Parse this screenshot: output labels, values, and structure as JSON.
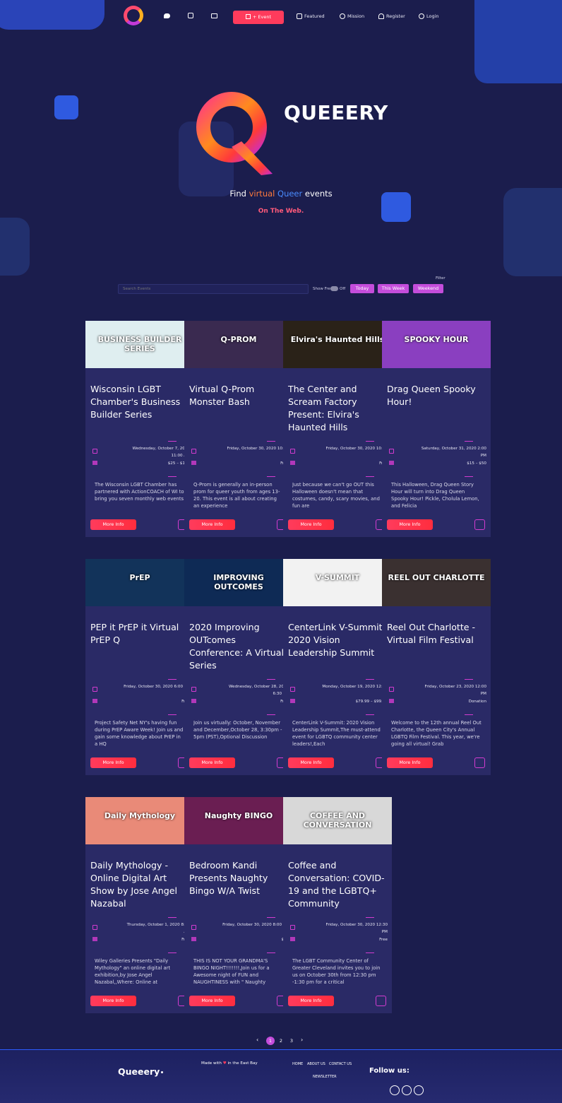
{
  "brand": {
    "name": "QUEEERY",
    "footer_name": "Queeery"
  },
  "colors": {
    "background": "#1b1d4d",
    "card": "#2a2a66",
    "accent_pink": "#ff3b5c",
    "accent_purple": "#c44ddb",
    "virtual_word": "#ff7a3d",
    "queer_word": "#4a8cff"
  },
  "header": {
    "social_icons": [
      "twitter-icon",
      "instagram-icon",
      "email-icon"
    ],
    "event_button": "+ Event",
    "nav": [
      {
        "label": "Featured",
        "icon": "featured-icon"
      },
      {
        "label": "Mission",
        "icon": "mission-icon"
      },
      {
        "label": "Register",
        "icon": "user-icon"
      },
      {
        "label": "Login",
        "icon": "power-icon"
      }
    ]
  },
  "hero": {
    "find": "Find",
    "virtual": "virtual",
    "queer": "Queer",
    "events": "events",
    "subtitle": "On The Web."
  },
  "filter": {
    "label": "Filter",
    "search_placeholder": "Search Events",
    "show_free_label": "Show Free",
    "toggle_state": "Off",
    "chips": [
      "Today",
      "This Week",
      "Weekend"
    ]
  },
  "events": [
    {
      "title": "Wisconsin LGBT Chamber's Business Builder Series",
      "date": "Wednesday, October 7, 2020 11:00 AM",
      "price": "$25 – $195",
      "description": "The Wisconsin LGBT Chamber has partnered with ActionCOACH of WI to bring you seven monthly web events",
      "thumb_bg": "#dfeef0",
      "thumb_text": "BUSINESS BUILDER SERIES"
    },
    {
      "title": "Virtual Q-Prom Monster Bash",
      "date": "Friday, October 30, 2020 10:30 PM",
      "price": "Free",
      "description": "Q-Prom is generally an in-person prom for queer youth from ages 13-20. This event is all about creating an experience",
      "thumb_bg": "#3a2a50",
      "thumb_text": "Q-PROM"
    },
    {
      "title": "The Center and Scream Factory Present: Elvira's Haunted Hills",
      "date": "Friday, October 30, 2020 10:00 PM",
      "price": "Free",
      "description": "Just because we can't go OUT this Halloween doesn't mean that costumes, candy, scary movies, and fun are",
      "thumb_bg": "#2a2218",
      "thumb_text": "Elvira's Haunted Hills"
    },
    {
      "title": "Drag Queen Spooky Hour!",
      "date": "Saturday, October 31, 2020 2:00 PM",
      "price": "$15 – $50",
      "description": "This Halloween, Drag Queen Story Hour will turn into Drag Queen Spooky Hour! Pickle, Cholula Lemon, and Felicia",
      "thumb_bg": "#8a3fc0",
      "thumb_text": "SPOOKY HOUR"
    },
    {
      "title": "PEP it PrEP it Virtual PrEP Q",
      "date": "Friday, October 30, 2020 6:00 PM",
      "price": "Free",
      "description": "Project Safety Net NY's having fun during PrEP Aware Week! Join us and gain some knowledge about PrEP in a HQ",
      "thumb_bg": "#12335a",
      "thumb_text": "PrEP"
    },
    {
      "title": "2020 Improving OUTcomes Conference: A Virtual Series",
      "date": "Wednesday, October 28, 2020 6:30 PM",
      "price": "Free",
      "description": "Join us virtually: October, November and December,October 28, 3:30pm - 5pm (PST),Optional Discussion",
      "thumb_bg": "#0e2a55",
      "thumb_text": "IMPROVING OUTCOMES"
    },
    {
      "title": "CenterLink V-Summit: 2020 Vision Leadership Summit",
      "date": "Monday, October 19, 2020 12:00 PM",
      "price": "$79.99 – $99.99",
      "description": "CenterLink V-Summit: 2020 Vision Leadership Summit,The must-attend event for LGBTQ community center leaders!,Each",
      "thumb_bg": "#f2f2f2",
      "thumb_text": "V-SUMMIT"
    },
    {
      "title": "Reel Out Charlotte - Virtual Film Festival",
      "date": "Friday, October 23, 2020 12:00 PM",
      "price": "Donation",
      "description": "Welcome to the 12th annual Reel Out Charlotte, the Queen City's Annual LGBTQ Film Festival. This year, we're going all virtual! Grab",
      "thumb_bg": "#3a3030",
      "thumb_text": "REEL OUT CHARLOTTE"
    },
    {
      "title": "Daily Mythology - Online Digital Art Show by Jose Angel Nazabal",
      "date": "Thursday, October 1, 2020 8:00 AM",
      "price": "Free",
      "description": "Wiley Galleries Presents \"Daily Mythology\" an online digital art exhibition,by Jose Angel Nazabal,,Where: Online at",
      "thumb_bg": "#e98a78",
      "thumb_text": "Daily Mythology"
    },
    {
      "title": "Bedroom Kandi Presents Naughty Bingo W/A Twist",
      "date": "Friday, October 30, 2020 8:00 PM",
      "price": "$25",
      "description": "THIS IS NOT YOUR GRANDMA'S BINGO NIGHT!!!!!!!,Join us for a Awesome night of FUN and NAUGHTINESS with \" Naughty",
      "thumb_bg": "#6a1e52",
      "thumb_text": "Naughty BINGO"
    },
    {
      "title": "Coffee and Conversation: COVID-19 and the LGBTQ+ Community",
      "date": "Friday, October 30, 2020 12:30 PM",
      "price": "Free",
      "description": "The LGBT Community Center of Greater Cleveland invites you to join us on October 30th from 12:30 pm -1:30 pm for a critical",
      "thumb_bg": "#d8d8d8",
      "thumb_text": "COFFEE AND CONVERSATION"
    }
  ],
  "card": {
    "more_info": "More Info"
  },
  "pagination": {
    "pages": [
      "1",
      "2",
      "3"
    ],
    "current": "1"
  },
  "footer": {
    "made_with": "Made with",
    "in_the": "in the East Bay",
    "links": [
      "HOME",
      "ABOUT US",
      "CONTACT US"
    ],
    "newsletter": "NEWSLETTER",
    "follow": "Follow us:",
    "social_icons": [
      "twitter-icon",
      "facebook-icon",
      "instagram-icon"
    ]
  }
}
